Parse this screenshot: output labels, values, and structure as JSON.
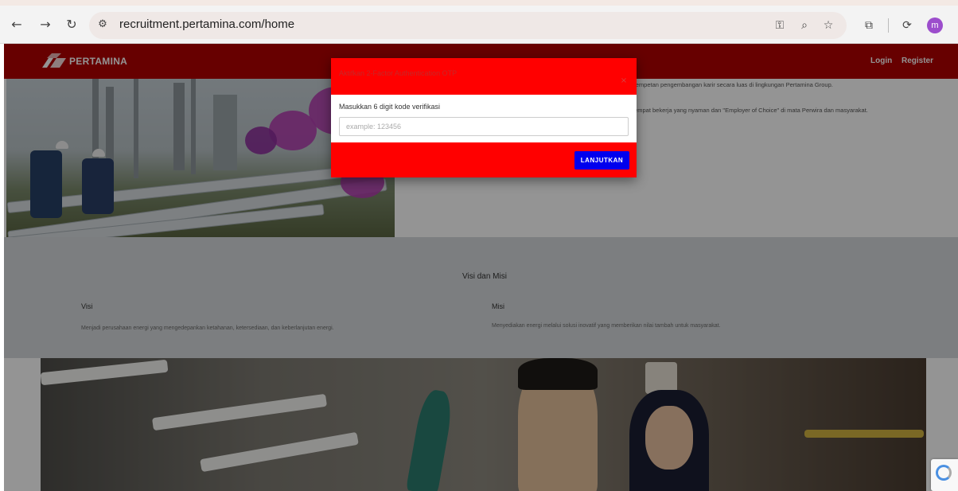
{
  "browser": {
    "url": "recruitment.pertamina.com/home",
    "avatar_letter": "m",
    "icons": [
      "back-icon",
      "forward-icon",
      "reload-icon",
      "site-info-icon",
      "key-icon",
      "zoom-icon",
      "star-icon",
      "extensions-icon",
      "sync-icon",
      "profile-avatar"
    ]
  },
  "header": {
    "brand": "PERTAMINA",
    "login": "Login",
    "register": "Register",
    "color": "#b20000"
  },
  "intro": {
    "line1": "kempetan pengembangan karir secara luas di lingkungan Pertamina Group.",
    "line2": "tempat bekerja yang nyaman dan \"Employer of Choice\" di mata Perwira dan masyarakat."
  },
  "visi_misi": {
    "title": "Visi dan Misi",
    "visi_heading": "Visi",
    "visi_text": "Menjadi perusahaan energi yang mengedepankan ketahanan, ketersediaan, dan keberlanjutan energi.",
    "misi_heading": "Misi",
    "misi_text": "Menyediakan energi melalui solusi inovatif yang memberikan nilai tambah untuk masyarakat."
  },
  "modal": {
    "title": "Aktifkan 2-Factor Authentication OTP",
    "close": "×",
    "label": "Masukkan 6 digit kode verifikasi",
    "placeholder": "example: 123456",
    "value": "",
    "button": "LANJUTKAN",
    "header_color": "#ff0000",
    "button_color": "#0000ee"
  }
}
